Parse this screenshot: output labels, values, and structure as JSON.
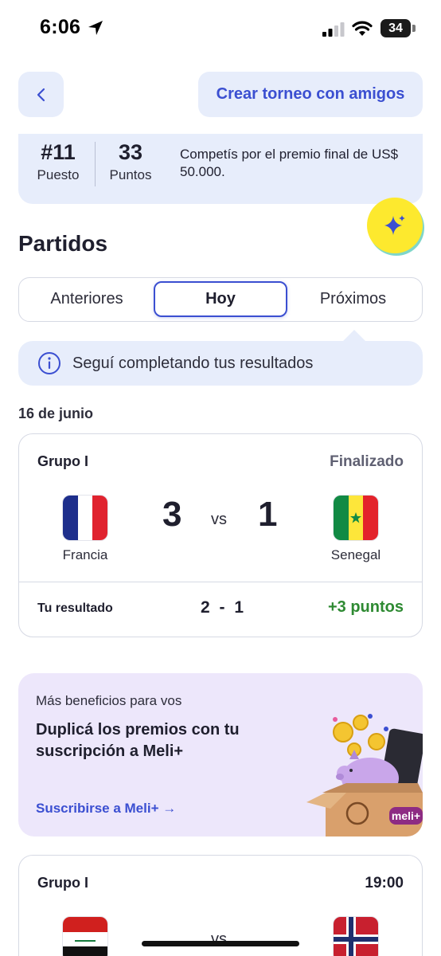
{
  "status_bar": {
    "time": "6:06",
    "battery": "34"
  },
  "header": {
    "create_label": "Crear torneo con amigos"
  },
  "ranking": {
    "position_value": "#11",
    "position_label": "Puesto",
    "points_value": "33",
    "points_label": "Puntos",
    "description": "Competís por el premio final de US$ 50.000."
  },
  "section_title": "Partidos",
  "tabs": [
    {
      "label": "Anteriores",
      "active": false
    },
    {
      "label": "Hoy",
      "active": true
    },
    {
      "label": "Próximos",
      "active": false
    }
  ],
  "info_banner": "Seguí completando tus resultados",
  "date_label": "16 de junio",
  "match1": {
    "group": "Grupo I",
    "status": "Finalizado",
    "home": "Francia",
    "away": "Senegal",
    "home_score": "3",
    "away_score": "1",
    "vs": "vs",
    "your_label": "Tu resultado",
    "your_score": "2 - 1",
    "points": "+3 puntos"
  },
  "promo": {
    "eyebrow": "Más beneficios para vos",
    "title": "Duplicá los premios con tu suscripción a Meli+",
    "link": "Suscribirse a Meli+ →",
    "badge": "meli+"
  },
  "match2": {
    "group": "Grupo I",
    "time": "19:00",
    "vs": "vs"
  },
  "colors": {
    "accent": "#3b4fd1",
    "card_bg": "#e7edfb",
    "promo_bg": "#ede7fb",
    "success": "#2e8a32",
    "sparkle_bg": "#fde92e"
  },
  "icons": [
    "location-arrow-icon",
    "signal-icon",
    "wifi-icon",
    "back-chevron-icon",
    "sparkle-icon",
    "info-icon"
  ]
}
